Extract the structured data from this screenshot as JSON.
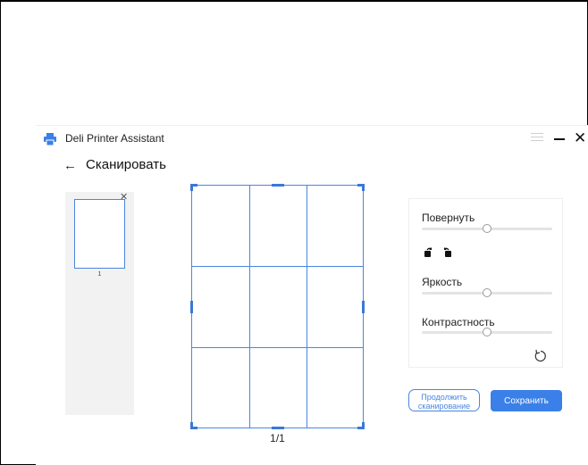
{
  "window": {
    "app_title": "Deli Printer Assistant"
  },
  "header": {
    "back_icon": "arrow-left-icon",
    "page_title": "Сканировать"
  },
  "thumbnails": {
    "items": [
      {
        "page_number": "1"
      }
    ]
  },
  "preview": {
    "page_counter": "1/1"
  },
  "controls": {
    "rotate_label": "Повернуть",
    "rotate_value": 0.5,
    "rotate_icons": [
      "rotate-left-icon",
      "rotate-right-icon"
    ],
    "brightness_label": "Яркость",
    "brightness_value": 0.5,
    "contrast_label": "Контрастность",
    "contrast_value": 0.5,
    "reset_icon": "reset-icon"
  },
  "actions": {
    "continue_line1": "Продолжить",
    "continue_line2": "сканирование",
    "save_label": "Сохранить"
  },
  "colors": {
    "accent": "#3a80e8",
    "panel_bg": "#f2f2f2"
  }
}
